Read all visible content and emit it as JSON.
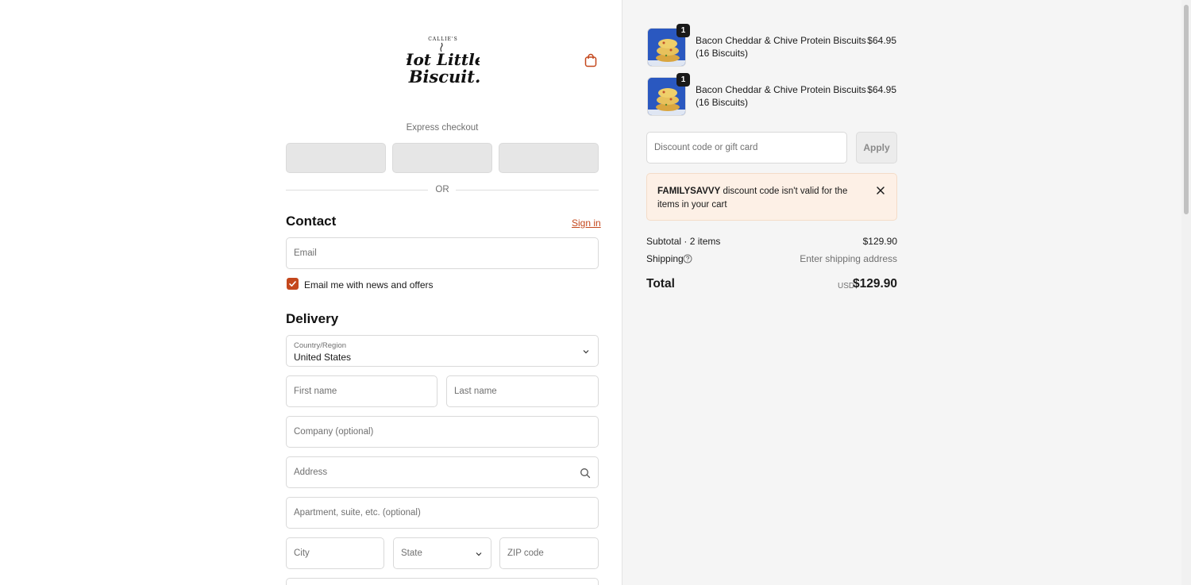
{
  "header": {
    "logo_alt": "Callie's Hot Little Biscuit",
    "logo_lines": [
      "CALLIE'S",
      "Hot Little",
      "Biscuit."
    ],
    "cart_icon": "shopping-bag-icon"
  },
  "express": {
    "label": "Express checkout",
    "or_label": "OR"
  },
  "contact": {
    "heading": "Contact",
    "sign_in_label": "Sign in",
    "email_placeholder": "Email",
    "newsletter_label": "Email me with news and offers",
    "newsletter_checked": true
  },
  "delivery": {
    "heading": "Delivery",
    "country_label": "Country/Region",
    "country_value": "United States",
    "first_name_placeholder": "First name",
    "last_name_placeholder": "Last name",
    "company_placeholder": "Company (optional)",
    "address_placeholder": "Address",
    "apartment_placeholder": "Apartment, suite, etc. (optional)",
    "city_placeholder": "City",
    "state_placeholder": "State",
    "zip_placeholder": "ZIP code"
  },
  "cart": {
    "items": [
      {
        "name": "Bacon Cheddar & Chive Protein Biscuits (16 Biscuits)",
        "price": "$64.95",
        "quantity": "1"
      },
      {
        "name": "Bacon Cheddar & Chive Protein Biscuits (16 Biscuits)",
        "price": "$64.95",
        "quantity": "1"
      }
    ],
    "discount_placeholder": "Discount code or gift card",
    "apply_label": "Apply",
    "alert": {
      "code": "FAMILYSAVVY",
      "message": " discount code isn't valid for the items in your cart"
    },
    "subtotal_label": "Subtotal · 2 items",
    "subtotal_value": "$129.90",
    "shipping_label": "Shipping",
    "shipping_value": "Enter shipping address",
    "total_label": "Total",
    "currency": "USD",
    "total_value": "$129.90"
  },
  "colors": {
    "accent": "#c4471c",
    "sidebar_bg": "#f5f5f5",
    "alert_bg": "#fdf0e6"
  }
}
